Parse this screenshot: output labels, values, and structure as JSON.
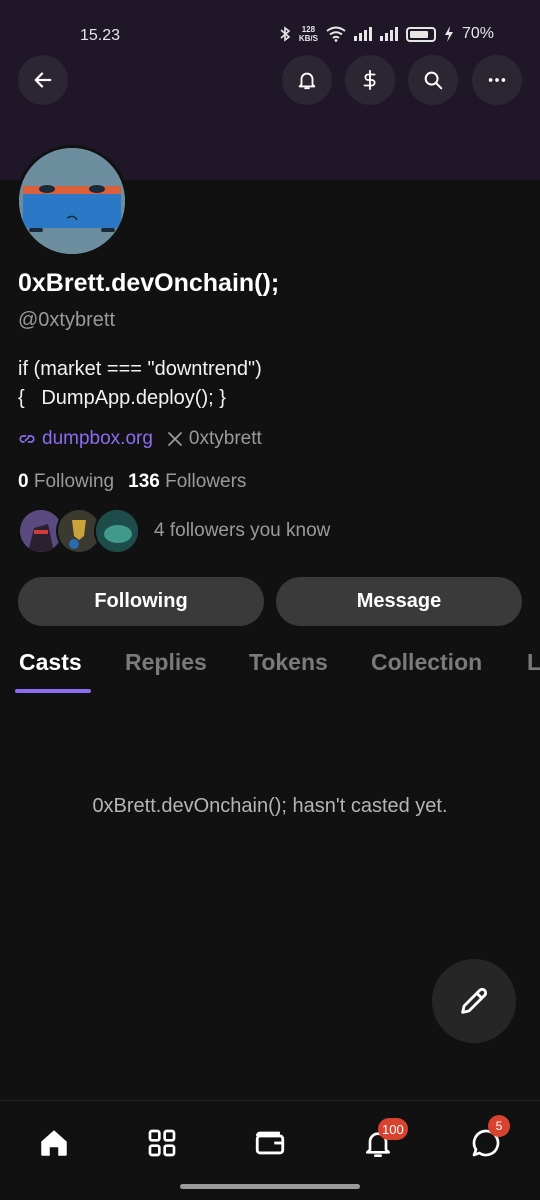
{
  "status": {
    "time": "15.23",
    "net_speed_value": "128",
    "net_speed_unit": "KB/S",
    "battery": "70%"
  },
  "profile": {
    "display_name": "0xBrett.devOnchain();",
    "handle": "@0xtybrett",
    "bio": "if (market === \"downtrend\")\n{   DumpApp.deploy(); }",
    "website": "dumpbox.org",
    "x_handle": "0xtybrett",
    "following_count": "0",
    "following_label": "Following",
    "followers_count": "136",
    "followers_label": "Followers",
    "followers_you_know": "4 followers you know"
  },
  "actions": {
    "following_label": "Following",
    "message_label": "Message"
  },
  "tabs": [
    {
      "label": "Casts"
    },
    {
      "label": "Replies"
    },
    {
      "label": "Tokens"
    },
    {
      "label": "Collection"
    },
    {
      "label": "L"
    }
  ],
  "empty_state": "0xBrett.devOnchain(); hasn't casted yet.",
  "nav": {
    "notifications_badge": "100",
    "messages_badge": "5"
  },
  "icons": [
    "back-arrow-icon",
    "bell-icon",
    "dollar-icon",
    "search-icon",
    "more-icon",
    "link-icon",
    "x-logo-icon",
    "pencil-icon",
    "home-icon",
    "grid-icon",
    "wallet-icon",
    "chat-icon"
  ],
  "colors": {
    "accent": "#8b6cf0",
    "banner": "#1f1628",
    "background": "#111111",
    "badge": "#d8432f"
  }
}
